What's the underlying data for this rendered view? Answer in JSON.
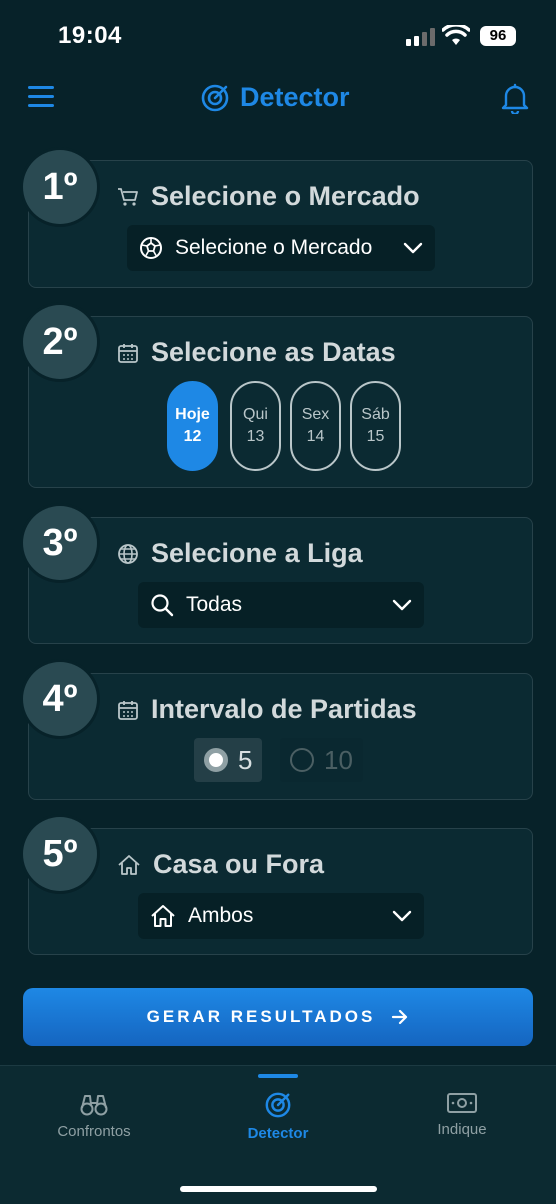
{
  "status_bar": {
    "time": "19:04",
    "battery": "96"
  },
  "header": {
    "title": "Detector"
  },
  "steps": [
    {
      "badge": "1º",
      "title": "Selecione o Mercado",
      "control_value": "Selecione o Mercado"
    },
    {
      "badge": "2º",
      "title": "Selecione as Datas",
      "dates": [
        {
          "day": "Hoje",
          "num": "12",
          "selected": true
        },
        {
          "day": "Qui",
          "num": "13",
          "selected": false
        },
        {
          "day": "Sex",
          "num": "14",
          "selected": false
        },
        {
          "day": "Sáb",
          "num": "15",
          "selected": false
        }
      ]
    },
    {
      "badge": "3º",
      "title": "Selecione a Liga",
      "control_value": "Todas"
    },
    {
      "badge": "4º",
      "title": "Intervalo de Partidas",
      "options": [
        {
          "label": "5",
          "selected": true
        },
        {
          "label": "10",
          "selected": false
        }
      ]
    },
    {
      "badge": "5º",
      "title": "Casa ou Fora",
      "control_value": "Ambos"
    }
  ],
  "cta": {
    "label": "GERAR RESULTADOS"
  },
  "bottom_nav": [
    {
      "label": "Confrontos",
      "icon": "binoculars-icon",
      "active": false
    },
    {
      "label": "Detector",
      "icon": "target-icon",
      "active": true
    },
    {
      "label": "Indique",
      "icon": "money-icon",
      "active": false
    }
  ],
  "colors": {
    "accent": "#1e88e5",
    "background": "#072229",
    "card": "#0b2a32"
  }
}
